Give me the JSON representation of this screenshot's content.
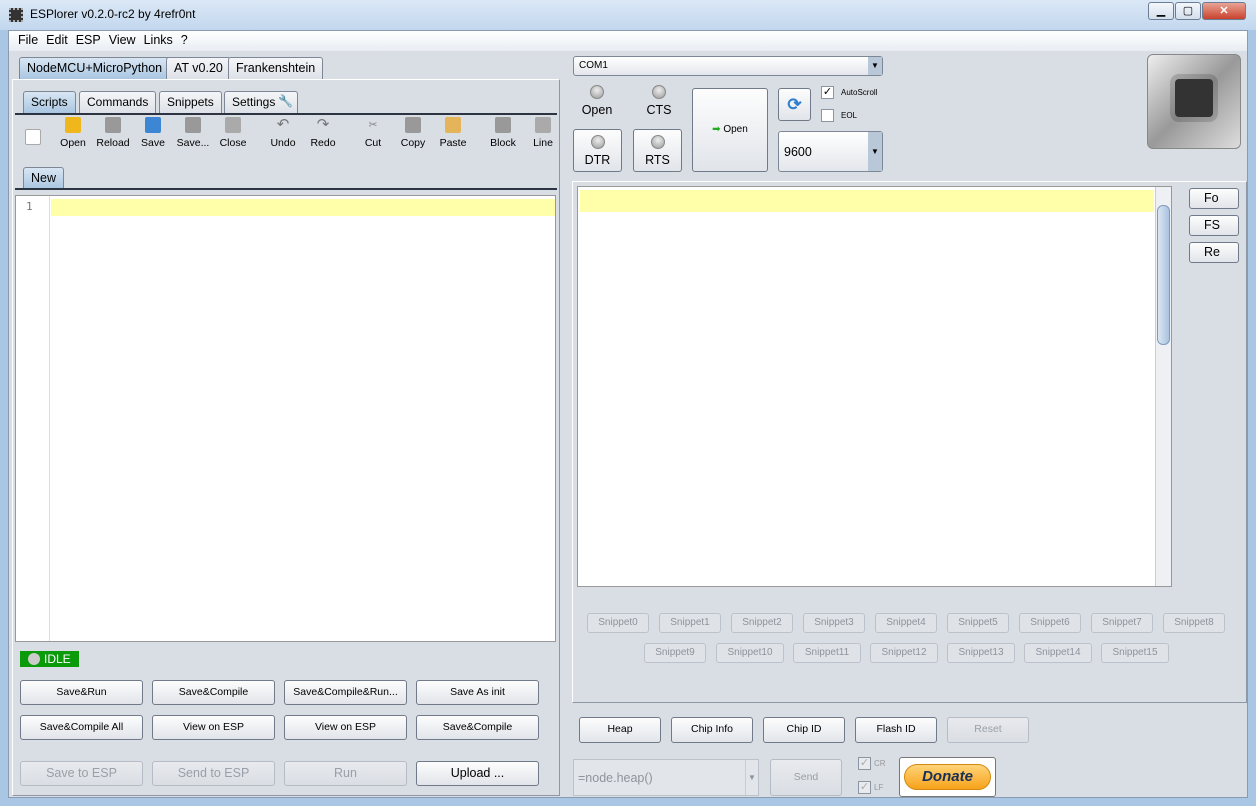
{
  "window": {
    "title": "ESPlorer v0.2.0-rc2 by 4refr0nt",
    "minimize": "▁",
    "maximize": "▢",
    "close": "✕"
  },
  "menu": [
    "File",
    "Edit",
    "ESP",
    "View",
    "Links",
    "?"
  ],
  "fw_tabs": [
    "NodeMCU+MicroPython",
    "AT v0.20",
    "Frankenshtein"
  ],
  "sub_tabs": [
    "Scripts",
    "Commands",
    "Snippets",
    "Settings"
  ],
  "toolbar": [
    "",
    "Open",
    "Reload",
    "Save",
    "Save...",
    "Close",
    "Undo",
    "Redo",
    "Cut",
    "Copy",
    "Paste",
    "Block",
    "Line"
  ],
  "file_tab": "New",
  "editor": {
    "line_number": "1"
  },
  "status": "IDLE",
  "script_buttons": [
    "Save&Run",
    "Save&Compile",
    "Save&Compile&Run...",
    "Save As init",
    "Save&Compile All",
    "View on ESP",
    "View on ESP",
    "Save&Compile"
  ],
  "bottom_buttons": [
    "Save to ESP",
    "Send to ESP",
    "Run",
    "Upload ..."
  ],
  "port": {
    "value": "COM1",
    "baud": "9600"
  },
  "signals": [
    "Open",
    "CTS",
    "DTR",
    "RTS"
  ],
  "open_button": "Open",
  "autoscroll": {
    "label": "AutoScroll",
    "checked": true
  },
  "eol": {
    "label": "EOL",
    "checked": false
  },
  "side_buttons": [
    "Fo",
    "FS",
    "Re"
  ],
  "snippets": [
    "Snippet0",
    "Snippet1",
    "Snippet2",
    "Snippet3",
    "Snippet4",
    "Snippet5",
    "Snippet6",
    "Snippet7",
    "Snippet8",
    "Snippet9",
    "Snippet10",
    "Snippet11",
    "Snippet12",
    "Snippet13",
    "Snippet14",
    "Snippet15"
  ],
  "cmd_buttons": [
    "Heap",
    "Chip Info",
    "Chip ID",
    "Flash ID",
    "Reset"
  ],
  "command": {
    "value": "=node.heap()",
    "send": "Send",
    "cr": "CR",
    "lf": "LF"
  },
  "donate": "Donate",
  "colors": {
    "status_idle": "#0a9a0a",
    "current_line": "#ffffaa",
    "donate": "#f7a21b"
  }
}
